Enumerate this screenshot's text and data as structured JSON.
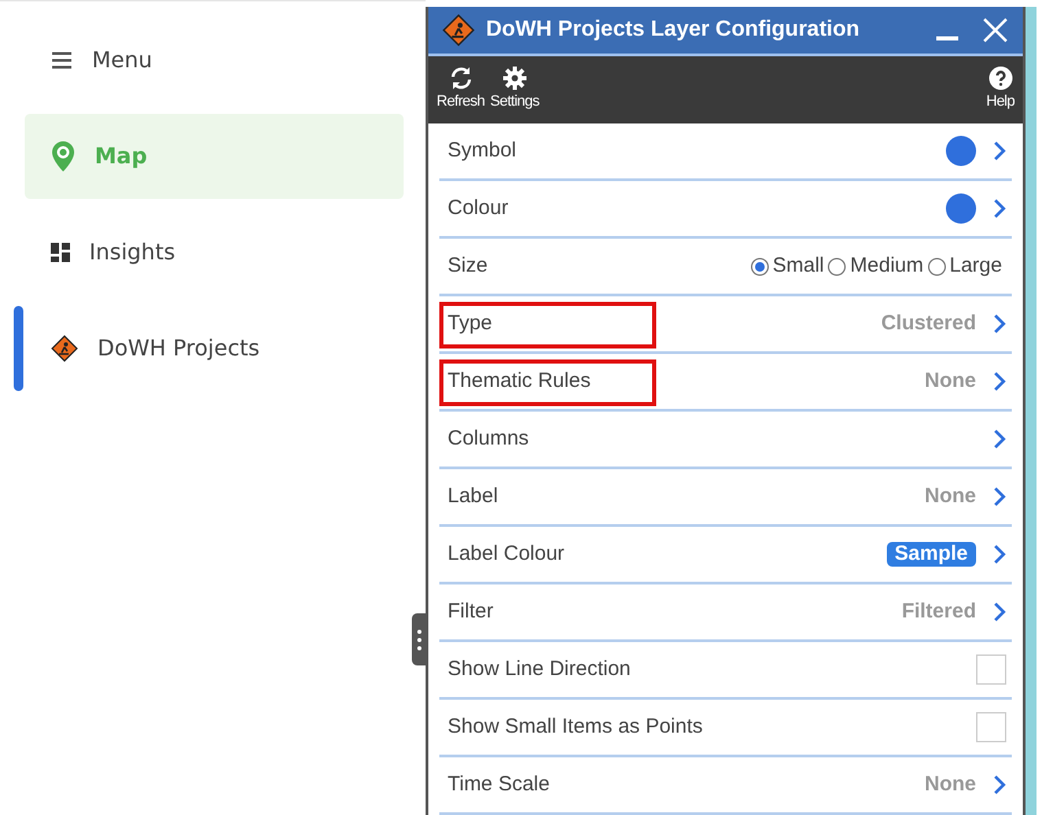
{
  "sidebar": {
    "items": [
      {
        "kind": "menu",
        "label": "Menu",
        "selected": false,
        "active": false
      },
      {
        "kind": "map",
        "label": "Map",
        "selected": true,
        "active": false
      },
      {
        "kind": "insights",
        "label": "Insights",
        "selected": false,
        "active": false
      },
      {
        "kind": "layer",
        "label": "DoWH Projects",
        "selected": false,
        "active": true
      }
    ]
  },
  "panel": {
    "title": "DoWH Projects Layer Configuration",
    "toolbar": [
      {
        "kind": "refresh",
        "label": "Refresh"
      },
      {
        "kind": "settings",
        "label": "Settings"
      },
      {
        "kind": "help",
        "label": "Help"
      }
    ],
    "rows": [
      {
        "kind": "color",
        "label": "Symbol",
        "color": "#2f6fdc",
        "highlighted": false
      },
      {
        "kind": "color",
        "label": "Colour",
        "color": "#2f6fdc",
        "highlighted": false
      },
      {
        "kind": "radio",
        "label": "Size",
        "highlighted": false,
        "options": [
          {
            "label": "Small",
            "selected": true
          },
          {
            "label": "Medium",
            "selected": false
          },
          {
            "label": "Large",
            "selected": false
          }
        ]
      },
      {
        "kind": "value",
        "label": "Type",
        "value": "Clustered",
        "highlighted": true
      },
      {
        "kind": "value",
        "label": "Thematic Rules",
        "value": "None",
        "highlighted": true
      },
      {
        "kind": "value",
        "label": "Columns",
        "highlighted": false
      },
      {
        "kind": "value",
        "label": "Label",
        "value": "None",
        "highlighted": false
      },
      {
        "kind": "sample",
        "label": "Label Colour",
        "value": "Sample",
        "highlighted": false
      },
      {
        "kind": "value",
        "label": "Filter",
        "value": "Filtered",
        "highlighted": false
      },
      {
        "kind": "checkbox",
        "label": "Show Line Direction",
        "checked": false,
        "highlighted": false
      },
      {
        "kind": "checkbox",
        "label": "Show Small Items as Points",
        "checked": false,
        "highlighted": false
      },
      {
        "kind": "value",
        "label": "Time Scale",
        "value": "None",
        "highlighted": false
      }
    ]
  }
}
